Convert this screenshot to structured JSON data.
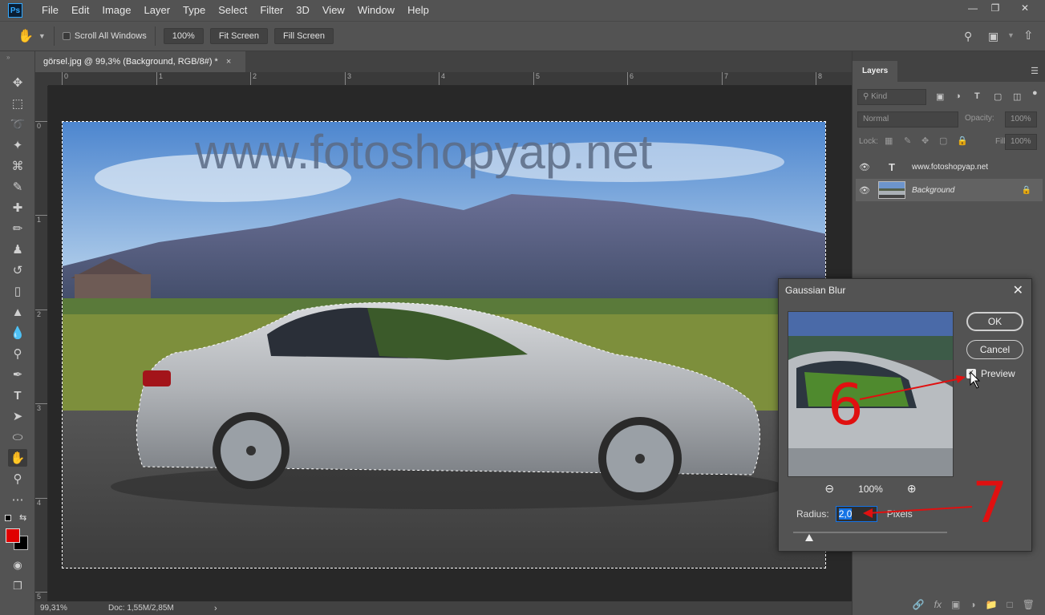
{
  "app": {
    "logo": "Ps"
  },
  "menu": [
    "File",
    "Edit",
    "Image",
    "Layer",
    "Type",
    "Select",
    "Filter",
    "3D",
    "View",
    "Window",
    "Help"
  ],
  "options": {
    "scroll_all_windows": "Scroll All Windows",
    "zoom_100": "100%",
    "fit_screen": "Fit Screen",
    "fill_screen": "Fill Screen"
  },
  "document": {
    "tab_title": "görsel.jpg @ 99,3% (Background, RGB/8#) *",
    "watermark": "www.fotoshopyap.net"
  },
  "rulers": {
    "h": [
      "0",
      "1",
      "2",
      "3",
      "4",
      "5",
      "6",
      "7",
      "8"
    ],
    "v": [
      "0",
      "1",
      "2",
      "3",
      "4",
      "5"
    ]
  },
  "status": {
    "zoom": "99,31%",
    "doc": "Doc: 1,55M/2,85M"
  },
  "layers_panel": {
    "tab": "Layers",
    "filter": "Kind",
    "blend_mode": "Normal",
    "opacity_label": "Opacity:",
    "opacity_value": "100%",
    "lock_label": "Lock:",
    "fill_label": "Fill:",
    "fill_value": "100%",
    "layers": [
      {
        "name": "www.fotoshopyap.net",
        "type": "text"
      },
      {
        "name": "Background",
        "type": "image"
      }
    ]
  },
  "dialog": {
    "title": "Gaussian Blur",
    "ok": "OK",
    "cancel": "Cancel",
    "preview_label": "Preview",
    "preview_checked": true,
    "zoom_value": "100%",
    "radius_label": "Radius:",
    "radius_value": "2,0",
    "radius_unit": "Pixels"
  },
  "annotations": {
    "step6": "6",
    "step7": "7"
  },
  "colors": {
    "foreground": "#e00000",
    "background": "#000000",
    "accent": "#1473e6",
    "annotation": "#e01010"
  }
}
